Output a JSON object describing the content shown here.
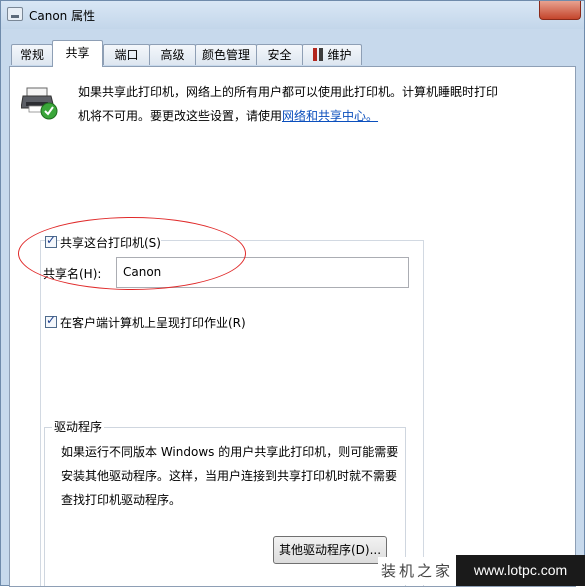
{
  "window": {
    "title": "Canon 属性"
  },
  "tabs": [
    {
      "label": "常规"
    },
    {
      "label": "共享"
    },
    {
      "label": "端口"
    },
    {
      "label": "高级"
    },
    {
      "label": "颜色管理"
    },
    {
      "label": "安全"
    },
    {
      "label": "维护"
    }
  ],
  "active_tab": "共享",
  "info": {
    "text": "如果共享此打印机，网络上的所有用户都可以使用此打印机。计算机睡眠时打印机将不可用。要更改这些设置，请使用",
    "link": "网络和共享中心。"
  },
  "share": {
    "checkbox_label": "共享这台打印机(S)",
    "checked": true,
    "name_label": "共享名(H):",
    "name_value": "Canon"
  },
  "render": {
    "checkbox_label": "在客户端计算机上呈现打印作业(R)",
    "checked": true
  },
  "drivers": {
    "legend": "驱动程序",
    "text": "如果运行不同版本 Windows 的用户共享此打印机，则可能需要安装其他驱动程序。这样，当用户连接到共享打印机时就不需要查找打印机驱动程序。",
    "button_label": "其他驱动程序(D)..."
  },
  "watermark": {
    "brand": "装机之家",
    "url": "www.lotpc.com"
  },
  "colors": {
    "link": "#0b4fbd",
    "annotation_ellipse": "#e02a2a",
    "window_frame": "#c7d9ec"
  }
}
